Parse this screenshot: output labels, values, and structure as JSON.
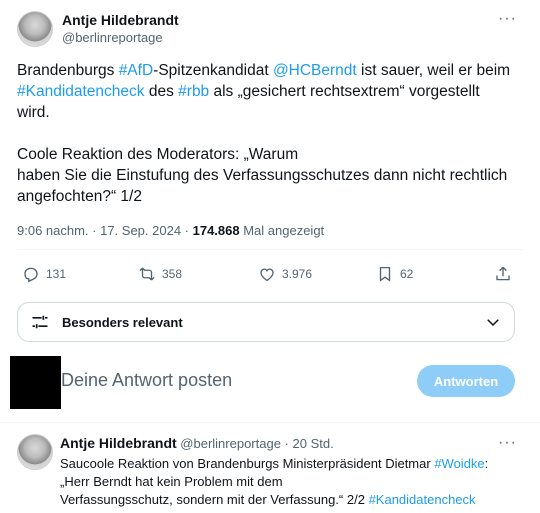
{
  "tweet": {
    "author": "Antje Hildebrandt",
    "handle": "@berlinreportage",
    "line1_a": "Brandenburgs ",
    "line1_b": "#AfD",
    "line1_c": "-Spitzenkandidat ",
    "line1_d": "@HCBerndt",
    "line1_e": " ist sauer, weil er beim",
    "line2_a": "#Kandidatencheck",
    "line2_b": " des ",
    "line2_c": "#rbb",
    "line2_d": " als „gesichert rechtsextrem“ vorgestellt",
    "line3": "wird.",
    "line4": "Coole Reaktion des Moderators: „Warum",
    "line5": "haben Sie die Einstufung des Verfassungsschutzes dann nicht rechtlich",
    "line6": "angefochten?“ 1/2",
    "time": "9:06 nachm. · 17. Sep. 2024 · ",
    "views": "174.868",
    "views_label": " Mal angezeigt"
  },
  "actions": {
    "replies": "131",
    "reposts": "358",
    "likes": "3.976",
    "bookmarks": "62"
  },
  "relevance": {
    "label": "Besonders relevant"
  },
  "reply_box": {
    "placeholder": "Deine Antwort posten",
    "button": "Antworten"
  },
  "reply": {
    "author": "Antje Hildebrandt",
    "handle": "@berlinreportage · 20 Std.",
    "line1_a": "Saucoole Reaktion von Brandenburgs Ministerpräsident Dietmar ",
    "line1_b": "#Woidke",
    "line1_c": ":",
    "line2": "„Herr Berndt hat kein Problem mit dem",
    "line3_a": "Verfassungsschutz, sondern mit der Verfassung.“ 2/2 ",
    "line3_b": "#Kandidatencheck"
  },
  "icons": {
    "more": "more-icon",
    "reply": "reply-icon",
    "repost": "repost-icon",
    "like": "heart-icon",
    "bookmark": "bookmark-icon",
    "share": "share-icon",
    "sliders": "sliders-icon",
    "chevron": "chevron-down-icon"
  },
  "colors": {
    "accent": "#1d9bf0",
    "button_disabled": "#8ecdf8",
    "muted": "#536471"
  }
}
